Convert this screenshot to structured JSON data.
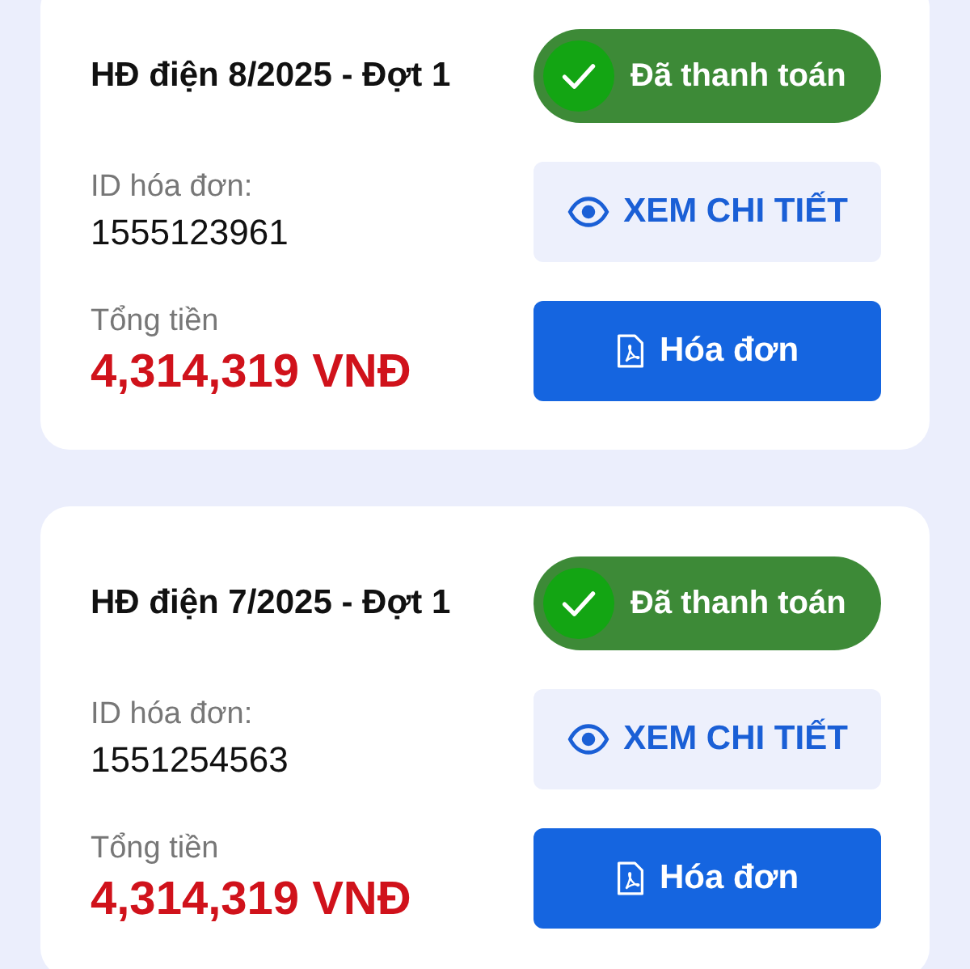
{
  "invoices": [
    {
      "title": "HĐ điện 8/2025 - Đợt 1",
      "status": {
        "label": "Đã thanh toán",
        "paid": true
      },
      "id_label": "ID hóa đơn:",
      "id": "1555123961",
      "total_label": "Tổng tiền",
      "total": "4,314,319 VNĐ",
      "details_button": "XEM CHI TIẾT",
      "invoice_button": "Hóa đơn"
    },
    {
      "title": "HĐ điện 7/2025 - Đợt 1",
      "status": {
        "label": "Đã thanh toán",
        "paid": true
      },
      "id_label": "ID hóa đơn:",
      "id": "1551254563",
      "total_label": "Tổng tiền",
      "total": "4,314,319 VNĐ",
      "details_button": "XEM CHI TIẾT",
      "invoice_button": "Hóa đơn"
    }
  ]
}
